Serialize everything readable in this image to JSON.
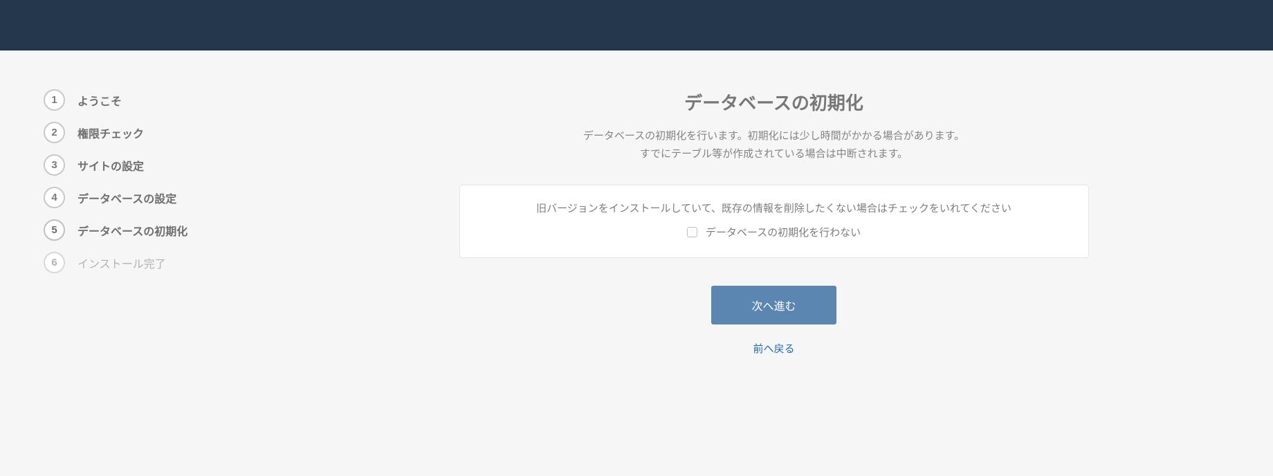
{
  "steps": [
    {
      "number": "1",
      "label": "ようこそ",
      "state": "completed"
    },
    {
      "number": "2",
      "label": "権限チェック",
      "state": "completed"
    },
    {
      "number": "3",
      "label": "サイトの設定",
      "state": "completed"
    },
    {
      "number": "4",
      "label": "データベースの設定",
      "state": "completed"
    },
    {
      "number": "5",
      "label": "データベースの初期化",
      "state": "current"
    },
    {
      "number": "6",
      "label": "インストール完了",
      "state": "pending"
    }
  ],
  "main": {
    "title": "データベースの初期化",
    "description_line1": "データベースの初期化を行います。初期化には少し時間がかかる場合があります。",
    "description_line2": "すでにテーブル等が作成されている場合は中断されます。",
    "card_text": "旧バージョンをインストールしていて、既存の情報を削除したくない場合はチェックをいれてください",
    "checkbox_label": "データベースの初期化を行わない",
    "next_button": "次へ進む",
    "back_link": "前へ戻る"
  }
}
